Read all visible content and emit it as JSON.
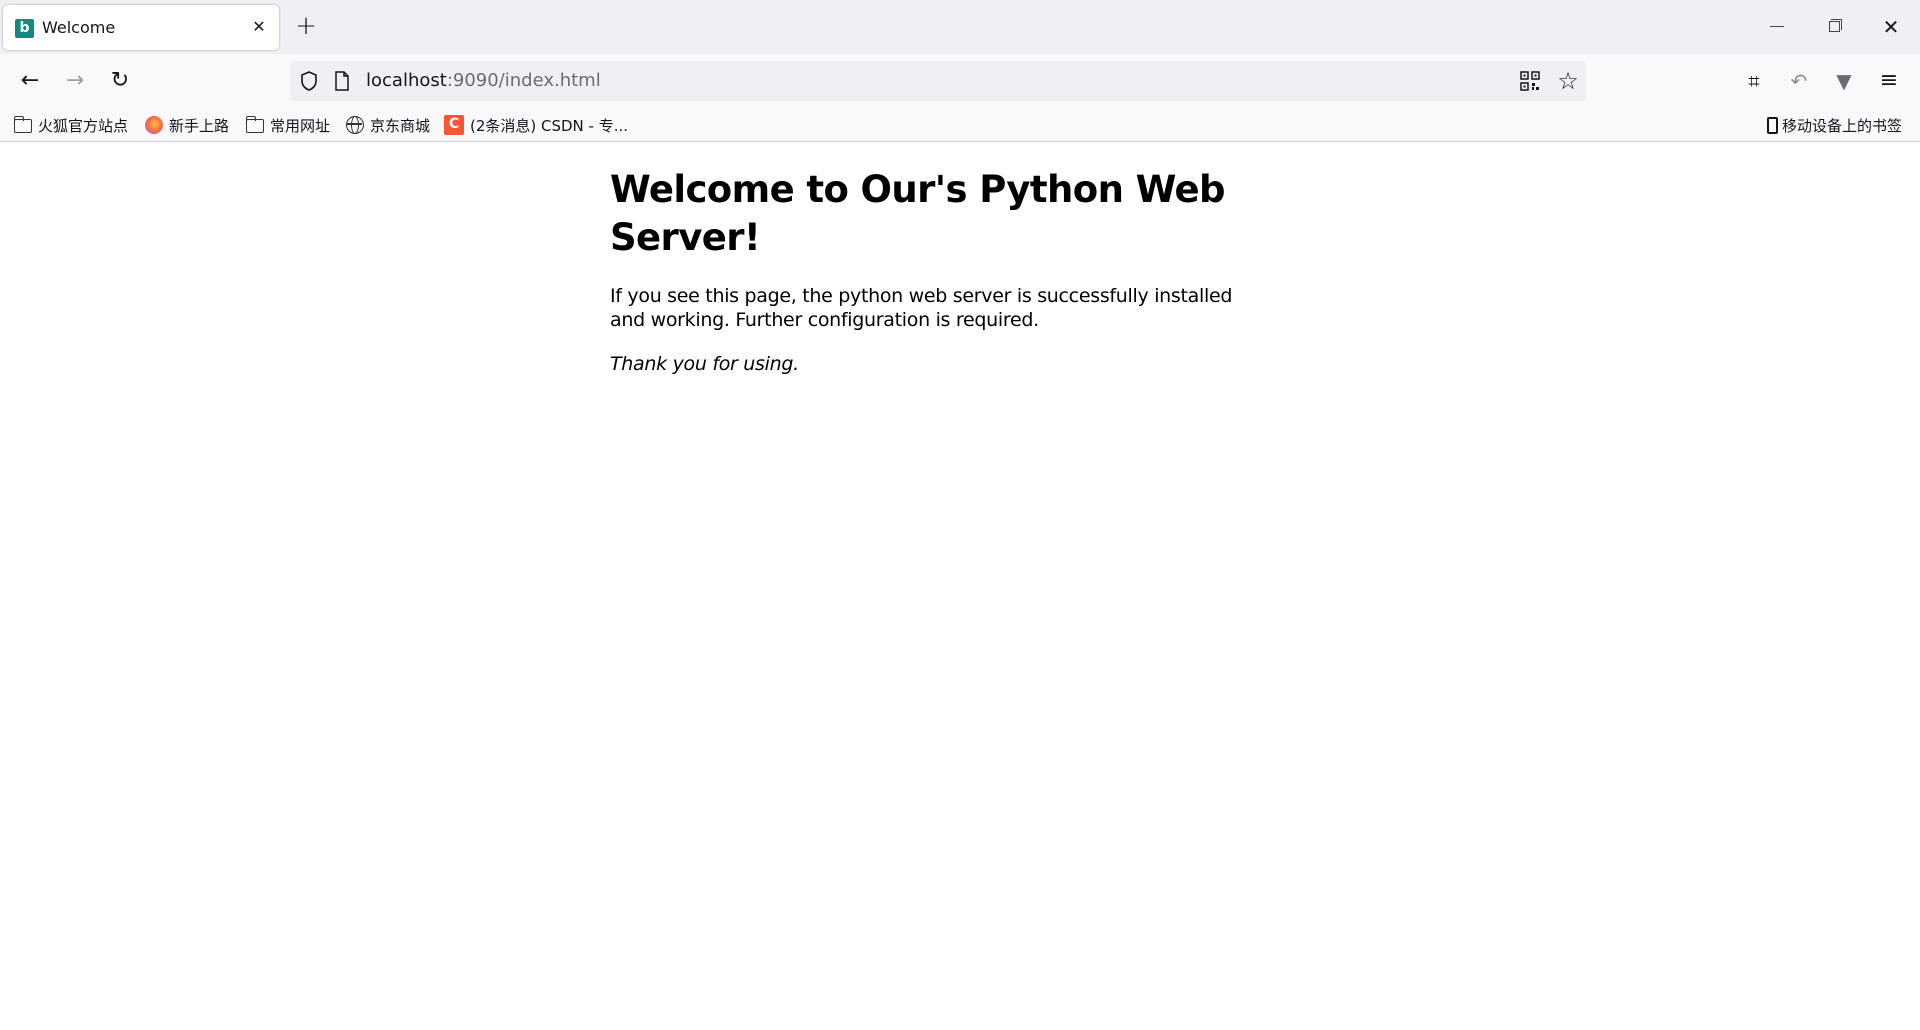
{
  "tab": {
    "title": "Welcome",
    "favicon_letter": "b",
    "close_glyph": "✕"
  },
  "newtab_glyph": "+",
  "window_controls": {
    "minimize": "",
    "close": "✕"
  },
  "nav": {
    "back_glyph": "←",
    "forward_glyph": "→",
    "reload_glyph": "↻"
  },
  "url": {
    "host": "localhost",
    "rest": ":9090/index.html"
  },
  "toolbar": {
    "star_glyph": "☆",
    "crop_glyph": "⌗",
    "undo_glyph": "↶",
    "vivaldi_glyph": "▼",
    "menu_glyph": "≡"
  },
  "bookmarks": {
    "items": [
      {
        "label": "火狐官方站点",
        "icon": "folder-icon"
      },
      {
        "label": "新手上路",
        "icon": "firefox-icon"
      },
      {
        "label": "常用网址",
        "icon": "folder-icon"
      },
      {
        "label": "京东商城",
        "icon": "globe-icon"
      },
      {
        "label": "(2条消息) CSDN - 专...",
        "icon": "csdn-icon",
        "icon_letter": "C"
      }
    ],
    "mobile": "移动设备上的书签"
  },
  "page": {
    "heading": "Welcome to Our's Python Web Server!",
    "body": "If you see this page, the python web server is successfully installed and working. Further configuration is required.",
    "thanks": "Thank you for using."
  }
}
